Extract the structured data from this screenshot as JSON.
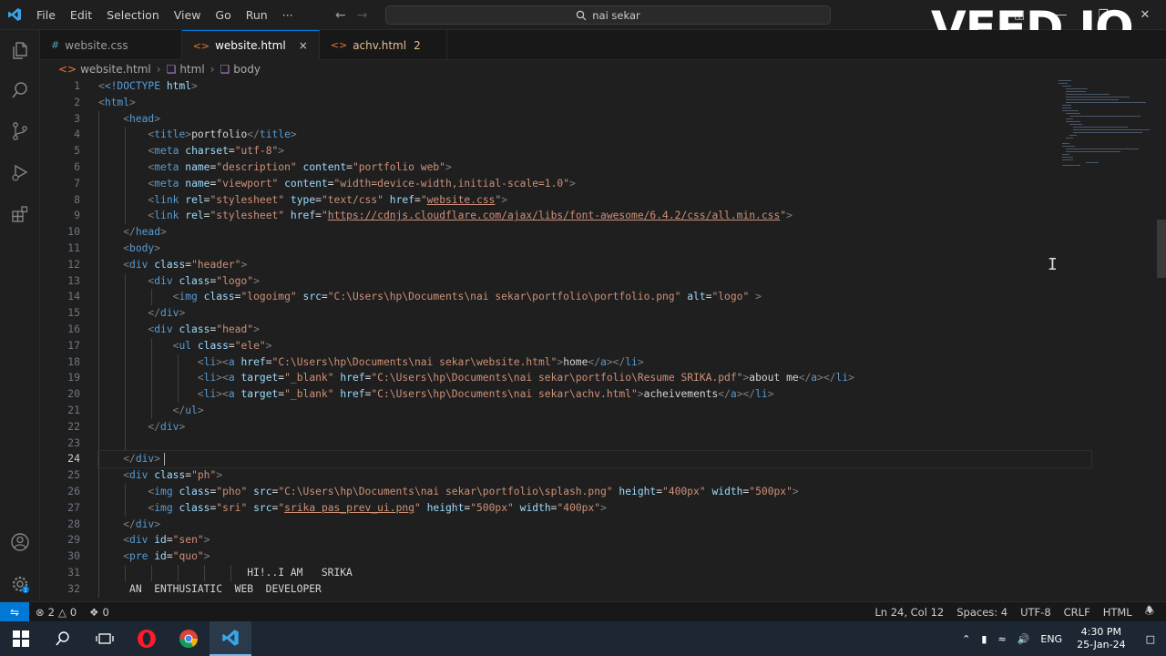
{
  "menu": [
    "File",
    "Edit",
    "Selection",
    "View",
    "Go",
    "Run",
    "···"
  ],
  "search": {
    "text": "nai sekar"
  },
  "watermark": "VEED.IO",
  "tabs": [
    {
      "icon": "#",
      "label": "website.css",
      "active": false
    },
    {
      "icon": "<>",
      "label": "website.html",
      "active": true,
      "close": "×"
    },
    {
      "icon": "<>",
      "label": "achv.html",
      "count": "2",
      "active": false
    }
  ],
  "breadcrumb": {
    "file": "website.html",
    "item1": "html",
    "item2": "body"
  },
  "editor": {
    "line_numbers": [
      "1",
      "2",
      "3",
      "4",
      "5",
      "6",
      "7",
      "8",
      "9",
      "10",
      "11",
      "12",
      "13",
      "14",
      "15",
      "16",
      "17",
      "18",
      "19",
      "20",
      "21",
      "22",
      "23",
      "24",
      "25",
      "26",
      "27",
      "28",
      "29",
      "30",
      "31",
      "32"
    ],
    "current_line": "24"
  },
  "code": {
    "l1": {
      "a": "<!DOCTYPE ",
      "b": "html",
      "c": ">"
    },
    "l2": "html",
    "l3": "head",
    "l4": {
      "tag": "title",
      "text": "portfolio"
    },
    "l5": {
      "attr": "charset",
      "val": "\"utf-8\""
    },
    "l6": {
      "a1": "name",
      "v1": "\"description\"",
      "a2": "content",
      "v2": "\"portfolio web\""
    },
    "l7": {
      "a1": "name",
      "v1": "\"viewport\"",
      "a2": "content",
      "v2": "\"width=device-width,initial-scale=1.0\""
    },
    "l8": {
      "a1": "rel",
      "v1": "\"stylesheet\"",
      "a2": "type",
      "v2": "\"text/css\"",
      "a3": "href",
      "q": "\"",
      "link": "website.css"
    },
    "l9": {
      "a1": "rel",
      "v1": "\"stylesheet\"",
      "a2": "href",
      "q": "\"",
      "link": "https://cdnjs.cloudflare.com/ajax/libs/font-awesome/6.4.2/css/all.min.css"
    },
    "l10": "head",
    "l11": "body",
    "l12": {
      "attr": "class",
      "val": "\"header\""
    },
    "l13": {
      "attr": "class",
      "val": "\"logo\""
    },
    "l14": {
      "a1": "class",
      "v1": "\"logoimg\"",
      "a2": "src",
      "v2": "\"C:\\Users\\hp\\Documents\\nai sekar\\portfolio\\portfolio.png\"",
      "a3": "alt",
      "v3": "\"logo\""
    },
    "l15": "div",
    "l16": {
      "attr": "class",
      "val": "\"head\""
    },
    "l17": {
      "attr": "class",
      "val": "\"ele\""
    },
    "l18": {
      "a1": "href",
      "v1": "\"C:\\Users\\hp\\Documents\\nai sekar\\website.html\"",
      "text": "home"
    },
    "l19": {
      "a1": "target",
      "v1": "\"_blank\"",
      "a2": "href",
      "v2": "\"C:\\Users\\hp\\Documents\\nai sekar\\portfolio\\Resume SRIKA.pdf\"",
      "text": "about me"
    },
    "l20": {
      "a1": "target",
      "v1": "\"_blank\"",
      "a2": "href",
      "v2": "\"C:\\Users\\hp\\Documents\\nai sekar\\achv.html\"",
      "text": "acheivements"
    },
    "l21": "ul",
    "l22": "div",
    "l24": "div",
    "l25": {
      "attr": "class",
      "val": "\"ph\""
    },
    "l26": {
      "a1": "class",
      "v1": "\"pho\"",
      "a2": "src",
      "v2": "\"C:\\Users\\hp\\Documents\\nai sekar\\portfolio\\splash.png\"",
      "a3": "height",
      "v3": "\"400px\"",
      "a4": "width",
      "v4": "\"500px\""
    },
    "l27": {
      "a1": "class",
      "v1": "\"sri\"",
      "a2": "src",
      "q": "\"",
      "link": "srika pas_prev_ui.png",
      "a3": "height",
      "v3": "\"500px\"",
      "a4": "width",
      "v4": "\"400px\""
    },
    "l28": "div",
    "l29": {
      "attr": "id",
      "val": "\"sen\""
    },
    "l30": {
      "attr": "id",
      "val": "\"quo\""
    },
    "l31": "HI!..I AM   SRIKA",
    "l32": "AN  ENTHUSIATIC  WEB  DEVELOPER"
  },
  "status": {
    "errors": "2",
    "warnings": "0",
    "ports": "0",
    "position": "Ln 24, Col 12",
    "spaces": "Spaces: 4",
    "encoding": "UTF-8",
    "eol": "CRLF",
    "language": "HTML"
  },
  "tray": {
    "lang": "ENG",
    "time": "4:30 PM",
    "date": "25-Jan-24"
  },
  "colors": {
    "accent": "#0078d4",
    "tag": "#569cd6",
    "attr": "#9cdcfe",
    "string": "#ce9178",
    "taskbar": "#1c2733"
  }
}
